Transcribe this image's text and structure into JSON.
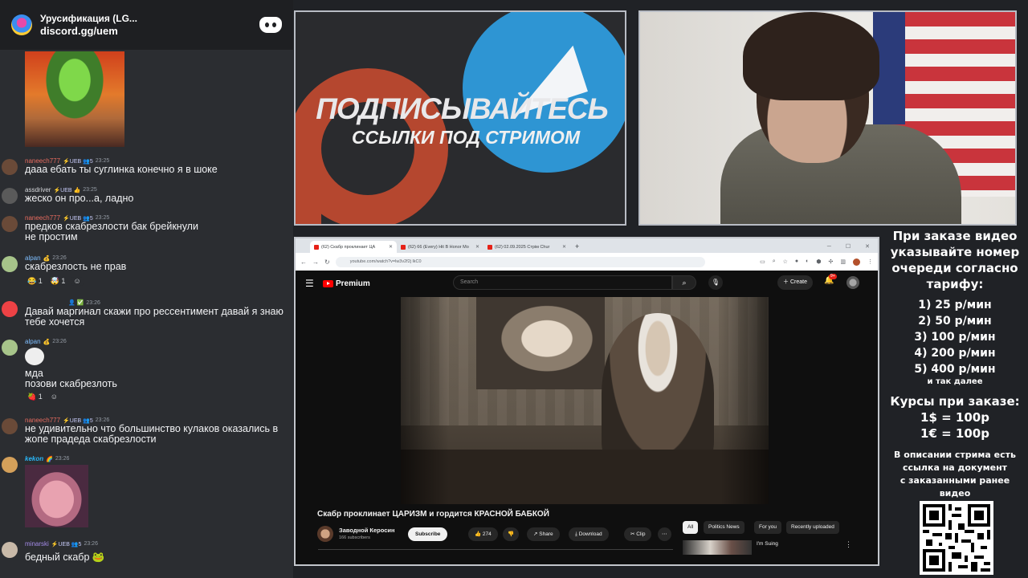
{
  "discord": {
    "server_name": "Урусификация (LG...",
    "invite": "discord.gg/uem",
    "messages": [
      {
        "name": "naneech777",
        "badge": "⚡UEB 👥5",
        "time": "23:25",
        "text": "дааа ебать ты суглинка конечно я в шоке",
        "name_color": "#e86b5f",
        "avatar_color": "#6a4a38"
      },
      {
        "name": "assdriver",
        "badge": "⚡UEB 👍",
        "time": "23:25",
        "text": "жеско он про...а, ладно",
        "name_color": "#d6d8dc",
        "avatar_color": "#5a5a5a"
      },
      {
        "name": "naneech777",
        "badge": "⚡UEB 👥5",
        "time": "23:25",
        "text": "предков скабрезлости бак брейкнули\nне простим",
        "name_color": "#e86b5f",
        "avatar_color": "#6a4a38"
      },
      {
        "name": "alpan",
        "badge": "💰",
        "time": "23:26",
        "text": "скабрезлость не прав",
        "name_color": "#7fbfff",
        "avatar_color": "#a7c48a"
      },
      {
        "name": "",
        "badge": "👤 ✅",
        "time": "23:26",
        "text": "Давай маргинал скажи про рессентимент давай я знаю тебе хочется",
        "name_color": "#d6d8dc",
        "avatar_color": "#ed4245"
      },
      {
        "name": "alpan",
        "badge": "💰",
        "time": "23:26",
        "text": "мда\nпозови скабрезлоть",
        "name_color": "#7fbfff",
        "avatar_color": "#a7c48a"
      },
      {
        "name": "naneech777",
        "badge": "⚡UEB 👥5",
        "time": "23:26",
        "text": "не удивительно что большинство кулаков оказались в жопе прадеда скабрезлости",
        "name_color": "#e86b5f",
        "avatar_color": "#6a4a38"
      },
      {
        "name": "kekon",
        "badge": "🌈",
        "time": "23:26",
        "text": "",
        "name_color": "#29b6f6",
        "avatar_color": "#d4a05a"
      },
      {
        "name": "minarski",
        "badge": "⚡UEB 👥5",
        "time": "23:26",
        "text": "бедный скабр 🐸",
        "name_color": "#a48be8",
        "avatar_color": "#c8b9a8"
      }
    ],
    "reactions_1": [
      "😂 1",
      "🤯 1",
      "☺"
    ],
    "reactions_2": [
      "🍓 1",
      "☺"
    ]
  },
  "promo": {
    "line1": "ПОДПИСЫВАЙТЕСЬ",
    "line2": "ССЫЛКИ ПОД СТРИМОМ"
  },
  "browser": {
    "tabs": [
      {
        "title": "(62) Скабр проклинает ЦА",
        "active": true
      },
      {
        "title": "(62) 66 (Every) Hit В Honor Mo",
        "active": false
      },
      {
        "title": "(62) 02.09.2025 Стрім Chur",
        "active": false
      }
    ],
    "url": "youtube.com/watch?v=lw3v2f2j lkC0",
    "youtube": {
      "brand": "Premium",
      "search_placeholder": "Search",
      "create_label": "Create",
      "notif_count": "9+",
      "video_title": "Скабр проклинает ЦАРИЗМ и гордится КРАСНОЙ БАБКОЙ",
      "channel_name": "Заводной Керосин",
      "subscribers": "166 subscribers",
      "subscribe_label": "Subscribe",
      "likes": "274",
      "share_label": "Share",
      "download_label": "Download",
      "clip_label": "Clip",
      "chips": [
        "All",
        "Politics News",
        "For you",
        "Recently uploaded"
      ],
      "rec_title": "I'm Suing"
    }
  },
  "info": {
    "l1": "При заказе видео",
    "l2": "указывайте номер",
    "l3": "очереди согласно",
    "l4": "тарифу:",
    "t1": "1) 25 р/мин",
    "t2": "2) 50 р/мин",
    "t3": "3) 100 р/мин",
    "t4": "4) 200 р/мин",
    "t5": "5) 400 р/мин",
    "etc": "и так далее",
    "rates_title": "Курсы при заказе:",
    "usd": "1$ = 100р",
    "eur": "1€ = 100р",
    "d1": "В описании стрима есть",
    "d2": "ссылка на документ",
    "d3": "с заказанными ранее",
    "d4": "видео"
  }
}
